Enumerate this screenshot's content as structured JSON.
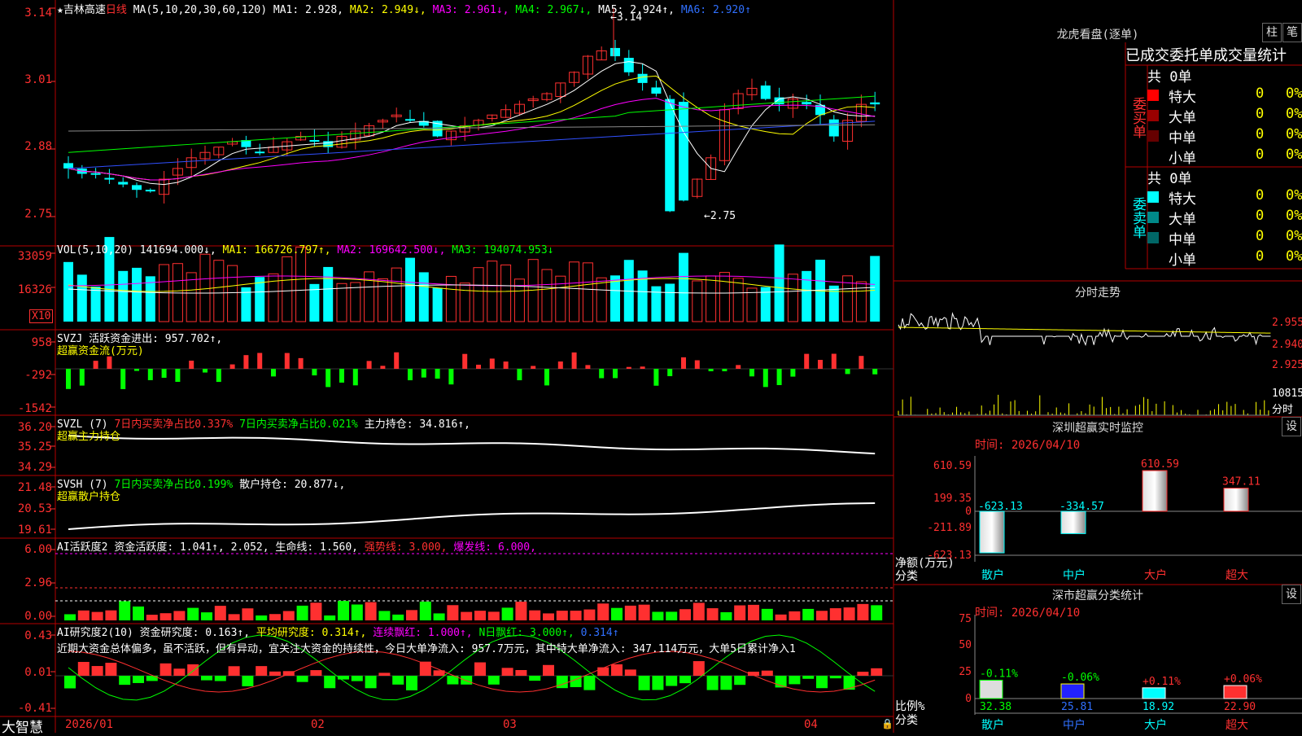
{
  "colors": {
    "up": "#ff3030",
    "down": "#00ffff",
    "grid": "#b40000",
    "ma5": "#ffffff",
    "ma10": "#ffff00",
    "ma20": "#ff00ff",
    "ma30": "#00ff00",
    "ma60": "#3050ff",
    "ma120": "#888888"
  },
  "icons": {
    "star": "star-icon",
    "lock": "lock-icon"
  },
  "price": {
    "header": {
      "star": "★",
      "name": "吉林高速",
      "period": "日线",
      "ma_label": "MA(5,10,20,30,60,120)",
      "ma1": "MA1: 2.928,",
      "ma2": "MA2: 2.949↓,",
      "ma3": "MA3: 2.961↓,",
      "ma4": "MA4: 2.967↓,",
      "ma5": "MA5: 2.924↑,",
      "ma6": "MA6: 2.920↑"
    },
    "ticks": [
      "3.14",
      "3.01",
      "2.88",
      "2.75"
    ],
    "high_label": "←3.14",
    "low_label": "←2.75"
  },
  "volume": {
    "header": {
      "vol": "VOL(5,10,20)",
      "val": "141694.000↓,",
      "ma1": "MA1: 166726.797↑,",
      "ma2": "MA2: 169642.500↓,",
      "ma3": "MA3: 194074.953↓"
    },
    "ticks": [
      "33059",
      "16326"
    ],
    "unit": "X10"
  },
  "svzj": {
    "header": {
      "name": "SVZJ",
      "label": "活跃资金进出: 957.702↑,"
    },
    "sub": "超赢资金流(万元)",
    "ticks": [
      "958",
      "-292",
      "-1542"
    ]
  },
  "svzl": {
    "header": {
      "name": "SVZL (7)",
      "a": "7日内买卖净占比0.337%",
      "b": "7日内买卖净占比0.021%",
      "c": "主力持仓: 34.816↑,"
    },
    "sub": "超赢主力持仓",
    "ticks": [
      "36.20",
      "35.25",
      "34.29"
    ]
  },
  "svsh": {
    "header": {
      "name": "SVSH (7)",
      "a": "7日内买卖净占比0.199%",
      "b": "散户持仓: 20.877↓,"
    },
    "sub": "超赢散户持仓",
    "ticks": [
      "21.48",
      "20.53",
      "19.61"
    ]
  },
  "ai_active": {
    "header": {
      "name": "AI活跃度2",
      "a": "资金活跃度: 1.041↑,",
      "b": "2.052,",
      "c": "生命线: 1.560,",
      "d": "强势线: 3.000,",
      "e": "爆发线: 6.000,"
    },
    "ticks": [
      "6.00",
      "2.96",
      "0.00"
    ]
  },
  "ai_research": {
    "header": {
      "name": "AI研究度2(10)",
      "a": "资金研究度: 0.163↑,",
      "b": "平均研究度: 0.314↑,",
      "c": "连续飘红: 1.000↑,",
      "d": "N日飘红: 3.000↑,",
      "e": "0.314↑"
    },
    "comment": "近期大资金总体偏多，虽不活跃，但有异动，宜关注大资金的持续性，今日大单净流入: 957.7万元，其中特大单净流入: 347.114万元，大单5日累计净入1",
    "ticks": [
      "0.43",
      "0.01",
      "-0.41"
    ]
  },
  "footer": {
    "brand": "大智慧",
    "dates": [
      "2026/01",
      "02",
      "03",
      "04"
    ]
  },
  "dragon": {
    "title": "龙虎看盘(逐单)",
    "btn1": "柱",
    "btn2": "笔",
    "tabs": [
      "已成交委托单",
      "成交量统计"
    ],
    "buy": {
      "label": "委买单",
      "total": "共 0单",
      "rows": [
        {
          "name": "特大",
          "v": "0",
          "p": "0%"
        },
        {
          "name": "大单",
          "v": "0",
          "p": "0%"
        },
        {
          "name": "中单",
          "v": "0",
          "p": "0%"
        },
        {
          "name": "小单",
          "v": "0",
          "p": "0%"
        }
      ]
    },
    "sell": {
      "label": "委卖单",
      "total": "共 0单",
      "rows": [
        {
          "name": "特大",
          "v": "0",
          "p": "0%"
        },
        {
          "name": "大单",
          "v": "0",
          "p": "0%"
        },
        {
          "name": "中单",
          "v": "0",
          "p": "0%"
        },
        {
          "name": "小单",
          "v": "0",
          "p": "0%"
        }
      ]
    }
  },
  "intraday": {
    "title": "分时走势",
    "ticks": [
      "2.955",
      "2.940",
      "2.925"
    ],
    "vol_label": "10815",
    "unit": "分时"
  },
  "sz_monitor": {
    "title": "深圳超赢实时监控",
    "btn": "设",
    "time": "时间: 2026/04/10",
    "yticks": [
      "610.59",
      "199.35",
      "0",
      "-211.89",
      "-623.13"
    ],
    "ylabel": "净额(万元)",
    "xlabel": "分类",
    "categories": [
      "散户",
      "中户",
      "大户",
      "超大"
    ],
    "values": [
      -623.13,
      -334.57,
      610.59,
      347.11
    ],
    "labels": [
      "-623.13",
      "-334.57",
      "610.59",
      "347.11"
    ]
  },
  "sz_class": {
    "title": "深市超赢分类统计",
    "btn": "设",
    "time": "时间: 2026/04/10",
    "yticks": [
      "75",
      "50",
      "25",
      "0"
    ],
    "ylabel": "比例%",
    "xlabel": "分类",
    "categories": [
      "散户",
      "中户",
      "大户",
      "超大"
    ],
    "values": [
      32.38,
      25.81,
      18.92,
      22.9
    ],
    "values_text": [
      "32.38",
      "25.81",
      "18.92",
      "22.90"
    ],
    "changes": [
      "-0.11%",
      "-0.06%",
      "+0.11%",
      "+0.06%"
    ]
  }
}
